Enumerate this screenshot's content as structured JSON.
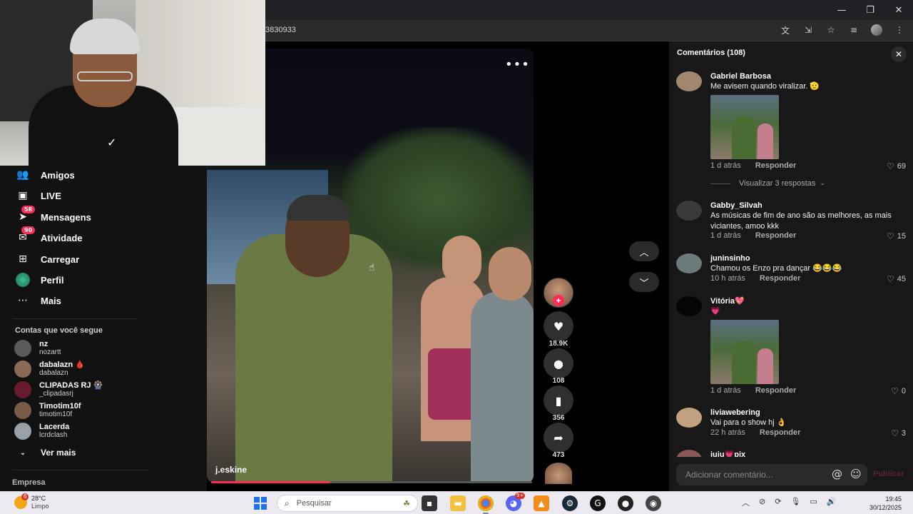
{
  "browser": {
    "url_fragment": "3830933",
    "window_controls": {
      "minimize": "—",
      "maximize": "❐",
      "close": "✕"
    },
    "address_icons": [
      "translate-icon",
      "install-icon",
      "star-icon",
      "media-icon",
      "profile-avatar",
      "menu-icon"
    ]
  },
  "sidebar": {
    "nav": [
      {
        "label": "Amigos",
        "icon": "friends-icon"
      },
      {
        "label": "LIVE",
        "icon": "live-icon"
      },
      {
        "label": "Mensagens",
        "icon": "messages-icon",
        "badge": "58"
      },
      {
        "label": "Atividade",
        "icon": "activity-icon",
        "badge": "90"
      },
      {
        "label": "Carregar",
        "icon": "upload-icon"
      },
      {
        "label": "Perfil",
        "icon": "profile-icon"
      },
      {
        "label": "Mais",
        "icon": "more-icon"
      }
    ],
    "following_title": "Contas que você segue",
    "following": [
      {
        "name": "nz",
        "username": "nozartt"
      },
      {
        "name": "dabalazn 🩸",
        "username": "dabalazn"
      },
      {
        "name": "CLIPADAS RJ 🎡",
        "username": "_clipadasrj"
      },
      {
        "name": "Timotim10f",
        "username": "timotim10f"
      },
      {
        "name": "Lacerda",
        "username": "lcrdclash"
      }
    ],
    "see_more": "Ver mais",
    "company": "Empresa"
  },
  "video": {
    "author": "j.eskine",
    "more_label": "•••",
    "progress": 0.37
  },
  "actions": {
    "likes": "18.9K",
    "comments": "108",
    "saves": "356",
    "shares": "473",
    "follow_plus": "+"
  },
  "comments_panel": {
    "title": "Comentários (108)",
    "close": "✕",
    "items": [
      {
        "name": "Gabriel Barbosa",
        "text": "Me avisem quando viralizar. 🫡",
        "time": "1 d atrás",
        "reply": "Responder",
        "likes": "69",
        "has_image": true,
        "view_replies": "Visualizar 3 respostas"
      },
      {
        "name": "Gabby_Silvah",
        "text": "As músicas de fim de ano são as melhores, as mais viciantes, amoo kkk",
        "time": "1 d atrás",
        "reply": "Responder",
        "likes": "15"
      },
      {
        "name": "juninsinho",
        "text": "Chamou os Enzo pra dançar 😂😂😂",
        "time": "10 h atrás",
        "reply": "Responder",
        "likes": "45"
      },
      {
        "name": "Vitória💖",
        "text": "💗",
        "time": "1 d atrás",
        "reply": "Responder",
        "likes": "0",
        "has_image": true
      },
      {
        "name": "liviawebering",
        "text": "Vai para o show hj 👌",
        "time": "22 h atrás",
        "reply": "Responder",
        "likes": "3"
      },
      {
        "name": "iuiu💗pix",
        "text": ""
      }
    ],
    "input_placeholder": "Adicionar comentário...",
    "publish": "Publicar"
  },
  "taskbar": {
    "weather_temp": "28°C",
    "weather_desc": "Limpo",
    "weather_badge": "6",
    "search_placeholder": "Pesquisar",
    "discord_badge": "9+",
    "time": "19:45",
    "date": "30/12/2025"
  },
  "colors": {
    "accent": "#fe2c55",
    "panel": "#181818",
    "background": "#121212"
  }
}
